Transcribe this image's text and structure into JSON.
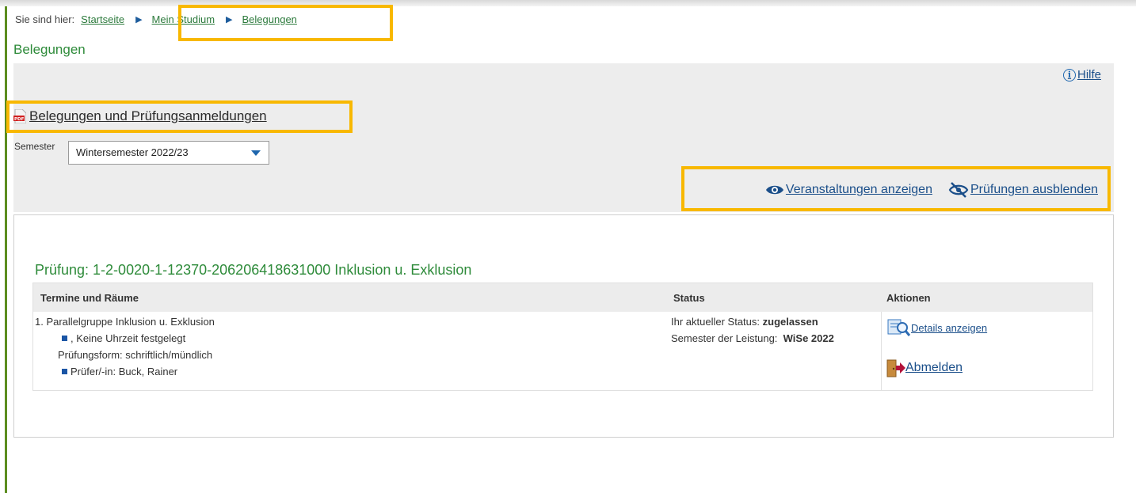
{
  "breadcrumb": {
    "prefix": "Sie sind hier:",
    "items": [
      "Startseite",
      "Mein Studium",
      "Belegungen"
    ]
  },
  "page_title": "Belegungen",
  "help_label": "Hilfe",
  "pdf_link": "Belegungen und Prüfungsanmeldungen",
  "semester": {
    "label": "Semester",
    "value": "Wintersemester 2022/23"
  },
  "toggles": {
    "show_courses": "Veranstaltungen anzeigen",
    "hide_exams": "Prüfungen ausblenden"
  },
  "exam": {
    "title": "Prüfung: 1-2-0020-1-12370-206206418631000 Inklusion u. Exklusion",
    "columns": [
      "Termine und Räume",
      "Status",
      "Aktionen"
    ],
    "group": "1. Parallelgruppe Inklusion u. Exklusion",
    "time": ", Keine Uhrzeit festgelegt",
    "form": "Prüfungsform: schriftlich/mündlich",
    "examiner_label": "Prüfer/-in:",
    "examiner": "Buck, Rainer",
    "status_label": "Ihr aktueller Status:",
    "status_value": "zugelassen",
    "semester_label": "Semester der Leistung:",
    "semester_value": "WiSe 2022",
    "actions": {
      "details": "Details anzeigen",
      "deregister": "Abmelden"
    }
  },
  "colors": {
    "green": "#2e8b3a",
    "link_blue": "#1b4f8a",
    "highlight": "#f8b800"
  }
}
